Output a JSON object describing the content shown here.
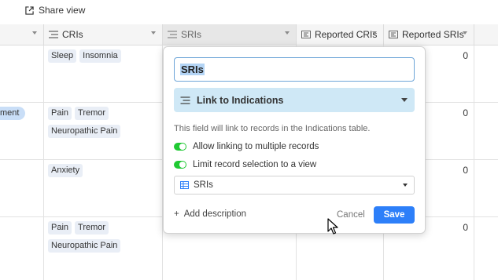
{
  "toolbar": {
    "share_label": "Share view"
  },
  "headers": [
    {
      "label": "",
      "icon": "none"
    },
    {
      "label": "CRIs",
      "icon": "multiselect-icon"
    },
    {
      "label": "SRIs",
      "icon": "multiselect-icon"
    },
    {
      "label": "Reported CRIs",
      "icon": "rollup-icon"
    },
    {
      "label": "Reported SRIs",
      "icon": "rollup-icon"
    }
  ],
  "rows": [
    {
      "left_pill": "",
      "cris": [
        "Sleep",
        "Insomnia"
      ],
      "reported": "0"
    },
    {
      "left_pill": "ment",
      "cris": [
        "Pain",
        "Tremor",
        "Neuropathic Pain"
      ],
      "reported": "0"
    },
    {
      "left_pill": "",
      "cris": [
        "Anxiety"
      ],
      "reported": "0"
    },
    {
      "left_pill": "",
      "cris": [
        "Pain",
        "Tremor",
        "Neuropathic Pain"
      ],
      "reported": "0"
    }
  ],
  "popover": {
    "field_name": "SRIs",
    "field_type": "Link to Indications",
    "description": "This field will link to records in the Indications table.",
    "toggle_multiple": "Allow linking to multiple records",
    "toggle_limit": "Limit record selection to a view",
    "view_selected": "SRIs",
    "add_description": "Add description",
    "cancel": "Cancel",
    "save": "Save"
  },
  "colors": {
    "accent": "#2d7ff9",
    "toggle_on": "#20c933",
    "type_bg": "#cfe8f6",
    "pill_bg": "#e9eef6"
  }
}
